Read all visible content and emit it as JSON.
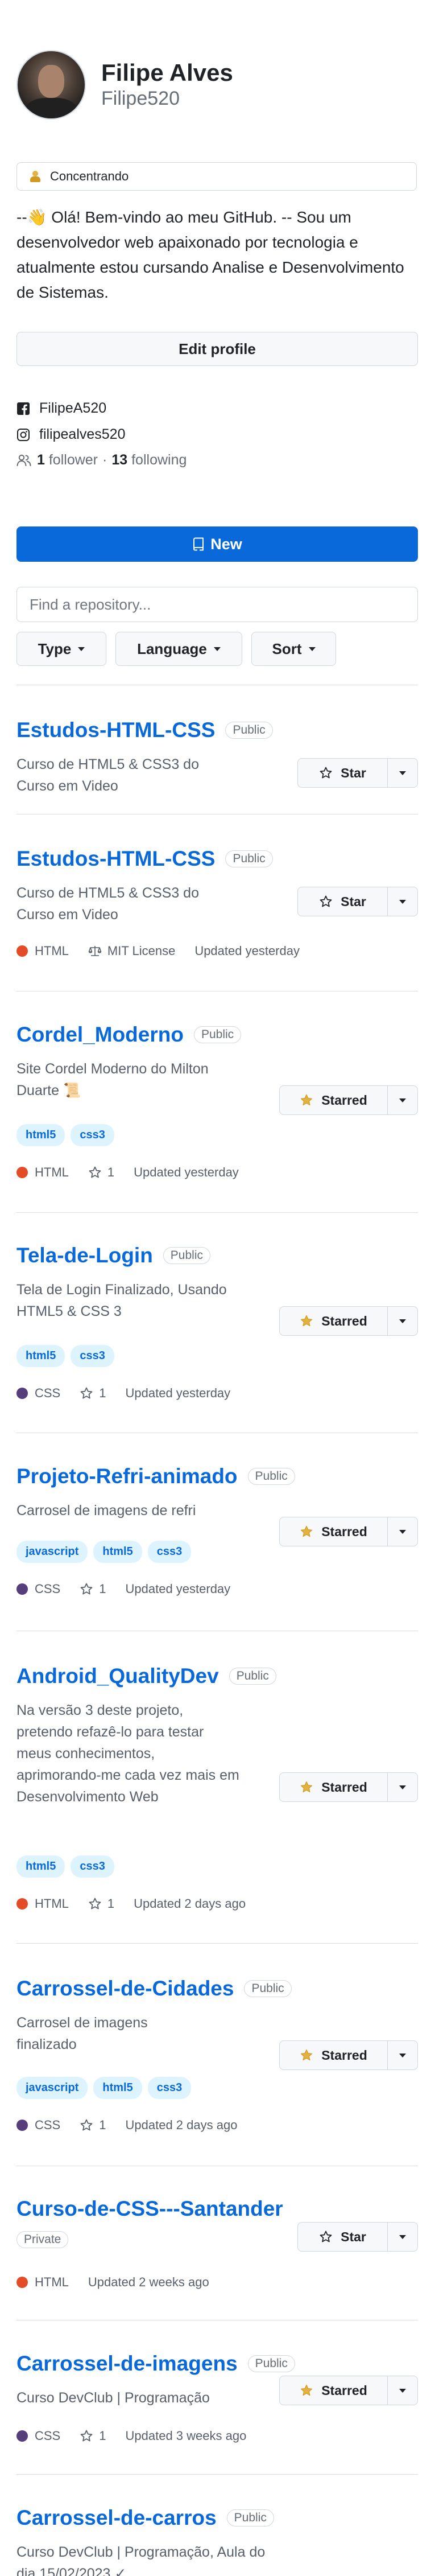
{
  "profile": {
    "name": "Filipe Alves",
    "login": "Filipe520",
    "status": "Concentrando",
    "bio": "--👋 Olá! Bem-vindo ao meu GitHub. -- Sou um desenvolvedor web apaixonado por tecnologia e atualmente estou cursando Analise e Desenvolvimento de Sistemas.",
    "edit_label": "Edit profile",
    "facebook": "FilipeA520",
    "instagram": "filipealves520",
    "followers_count": "1",
    "followers_label": "follower",
    "separator": "·",
    "following_count": "13",
    "following_label": "following"
  },
  "toolbar": {
    "new_label": "New",
    "search_placeholder": "Find a repository...",
    "filters": [
      "Type",
      "Language",
      "Sort"
    ]
  },
  "colors": {
    "link": "#0969da",
    "primary_button": "#0969da",
    "HTML": "#e34c26",
    "CSS": "#563d7c",
    "star_filled": "#e3b341"
  },
  "repos": [
    {
      "name": "Estudos-HTML-CSS",
      "visibility": "Public",
      "description": "Curso de HTML5 & CSS3 do Curso em Video",
      "topics": [],
      "language": "",
      "license": "",
      "stars": "",
      "updated": "",
      "star_label": "Star",
      "starred": false
    },
    {
      "name": "Estudos-HTML-CSS",
      "visibility": "Public",
      "description": "Curso de HTML5 & CSS3 do Curso em Video",
      "topics": [],
      "language": "HTML",
      "license": "MIT License",
      "stars": "",
      "updated": "Updated yesterday",
      "star_label": "Star",
      "starred": false
    },
    {
      "name": "Cordel_Moderno",
      "visibility": "Public",
      "description": "Site Cordel Moderno do Milton Duarte 📜",
      "topics": [
        "html5",
        "css3"
      ],
      "language": "HTML",
      "license": "",
      "stars": "1",
      "updated": "Updated yesterday",
      "star_label": "Starred",
      "starred": true
    },
    {
      "name": "Tela-de-Login",
      "visibility": "Public",
      "description": "Tela de Login Finalizado, Usando HTML5 & CSS 3",
      "topics": [
        "html5",
        "css3"
      ],
      "language": "CSS",
      "license": "",
      "stars": "1",
      "updated": "Updated yesterday",
      "star_label": "Starred",
      "starred": true
    },
    {
      "name": "Projeto-Refri-animado",
      "visibility": "Public",
      "description": "Carrosel de imagens de refri",
      "topics": [
        "javascript",
        "html5",
        "css3"
      ],
      "language": "CSS",
      "license": "",
      "stars": "1",
      "updated": "Updated yesterday",
      "star_label": "Starred",
      "starred": true
    },
    {
      "name": "Android_QualityDev",
      "visibility": "Public",
      "description": "Na versão 3 deste projeto, pretendo refazê-lo para testar meus conhecimentos, aprimorando-me cada vez mais em Desenvolvimento Web",
      "topics": [
        "html5",
        "css3"
      ],
      "language": "HTML",
      "license": "",
      "stars": "1",
      "updated": "Updated 2 days ago",
      "star_label": "Starred",
      "starred": true
    },
    {
      "name": "Carrossel-de-Cidades",
      "visibility": "Public",
      "description": "Carrosel de imagens finalizado",
      "topics": [
        "javascript",
        "html5",
        "css3"
      ],
      "language": "CSS",
      "license": "",
      "stars": "1",
      "updated": "Updated 2 days ago",
      "star_label": "Starred",
      "starred": true
    },
    {
      "name": "Curso-de-CSS---Santander",
      "visibility": "Private",
      "description": "",
      "topics": [],
      "language": "HTML",
      "license": "",
      "stars": "",
      "updated": "Updated 2 weeks ago",
      "star_label": "Star",
      "starred": false
    },
    {
      "name": "Carrossel-de-imagens",
      "visibility": "Public",
      "description": "Curso DevClub | Programação",
      "topics": [],
      "language": "CSS",
      "license": "",
      "stars": "1",
      "updated": "Updated 3 weeks ago",
      "star_label": "Starred",
      "starred": true
    },
    {
      "name": "Carrossel-de-carros",
      "visibility": "Public",
      "description": "Curso DevClub | Programação, Aula do dia 15/02/2023 ✓",
      "topics": [],
      "language": "",
      "license": "",
      "stars": "",
      "updated": "",
      "star_label": "",
      "starred": false
    }
  ]
}
